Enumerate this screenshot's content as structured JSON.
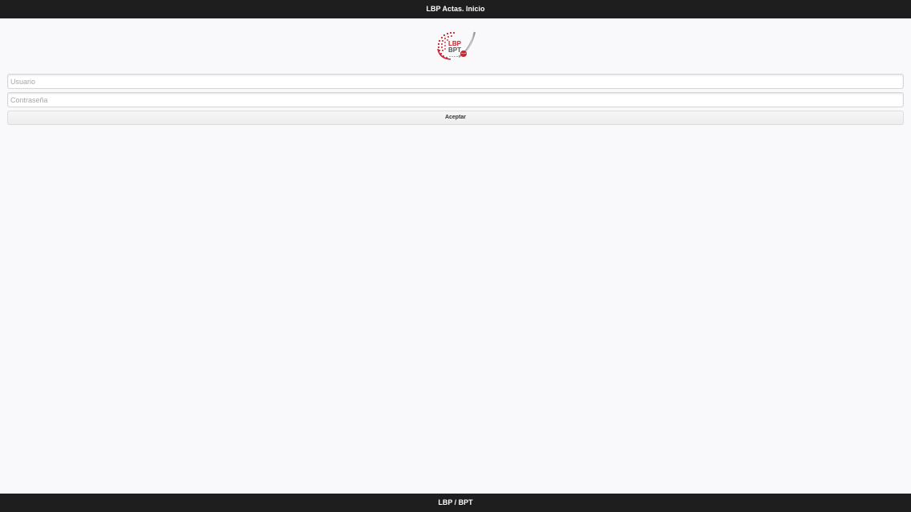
{
  "header": {
    "title": "LBP Actas. Inicio"
  },
  "logo": {
    "line1": "LBP",
    "line2": "BPT",
    "icon": "lbp-bpt-logo-icon",
    "colors": {
      "red": "#c8242c",
      "grey": "#9a9a9a"
    }
  },
  "form": {
    "username": {
      "value": "",
      "placeholder": "Usuario"
    },
    "password": {
      "value": "",
      "placeholder": "Contraseña"
    },
    "submit_label": "Aceptar"
  },
  "footer": {
    "text": "LBP / BPT"
  },
  "colors": {
    "bar_background": "#1e1e1e",
    "page_background": "#f9f8fa",
    "bar_text": "#ffffff"
  }
}
